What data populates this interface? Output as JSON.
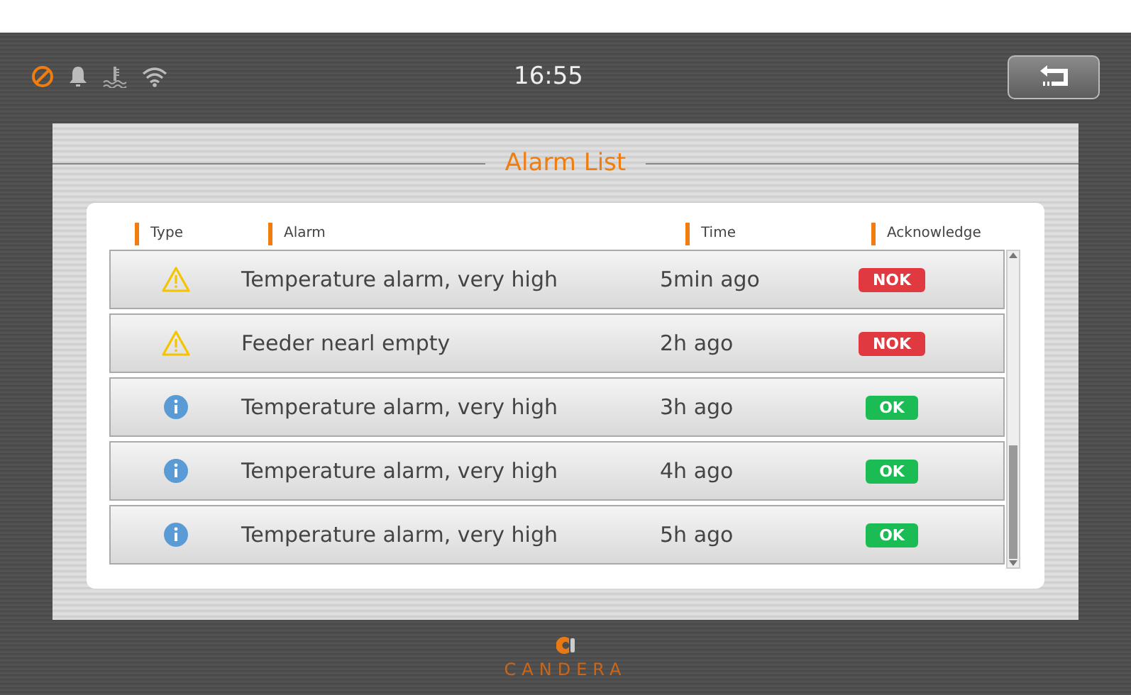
{
  "status_bar": {
    "time": "16:55"
  },
  "panel": {
    "title": "Alarm List"
  },
  "table": {
    "columns": [
      "Type",
      "Alarm",
      "Time",
      "Acknowledge"
    ],
    "rows": [
      {
        "kind": "warning",
        "alarm": "Temperature alarm, very high",
        "time": "5min ago",
        "acknowledged": false,
        "ack_label": "NOK"
      },
      {
        "kind": "warning",
        "alarm": "Feeder nearl empty",
        "time": "2h ago",
        "acknowledged": false,
        "ack_label": "NOK"
      },
      {
        "kind": "info",
        "alarm": "Temperature alarm, very high",
        "time": "3h ago",
        "acknowledged": true,
        "ack_label": "OK"
      },
      {
        "kind": "info",
        "alarm": "Temperature alarm, very high",
        "time": "4h ago",
        "acknowledged": true,
        "ack_label": "OK"
      },
      {
        "kind": "info",
        "alarm": "Temperature alarm, very high",
        "time": "5h ago",
        "acknowledged": true,
        "ack_label": "OK"
      }
    ]
  },
  "footer": {
    "brand": "CANDERA"
  }
}
